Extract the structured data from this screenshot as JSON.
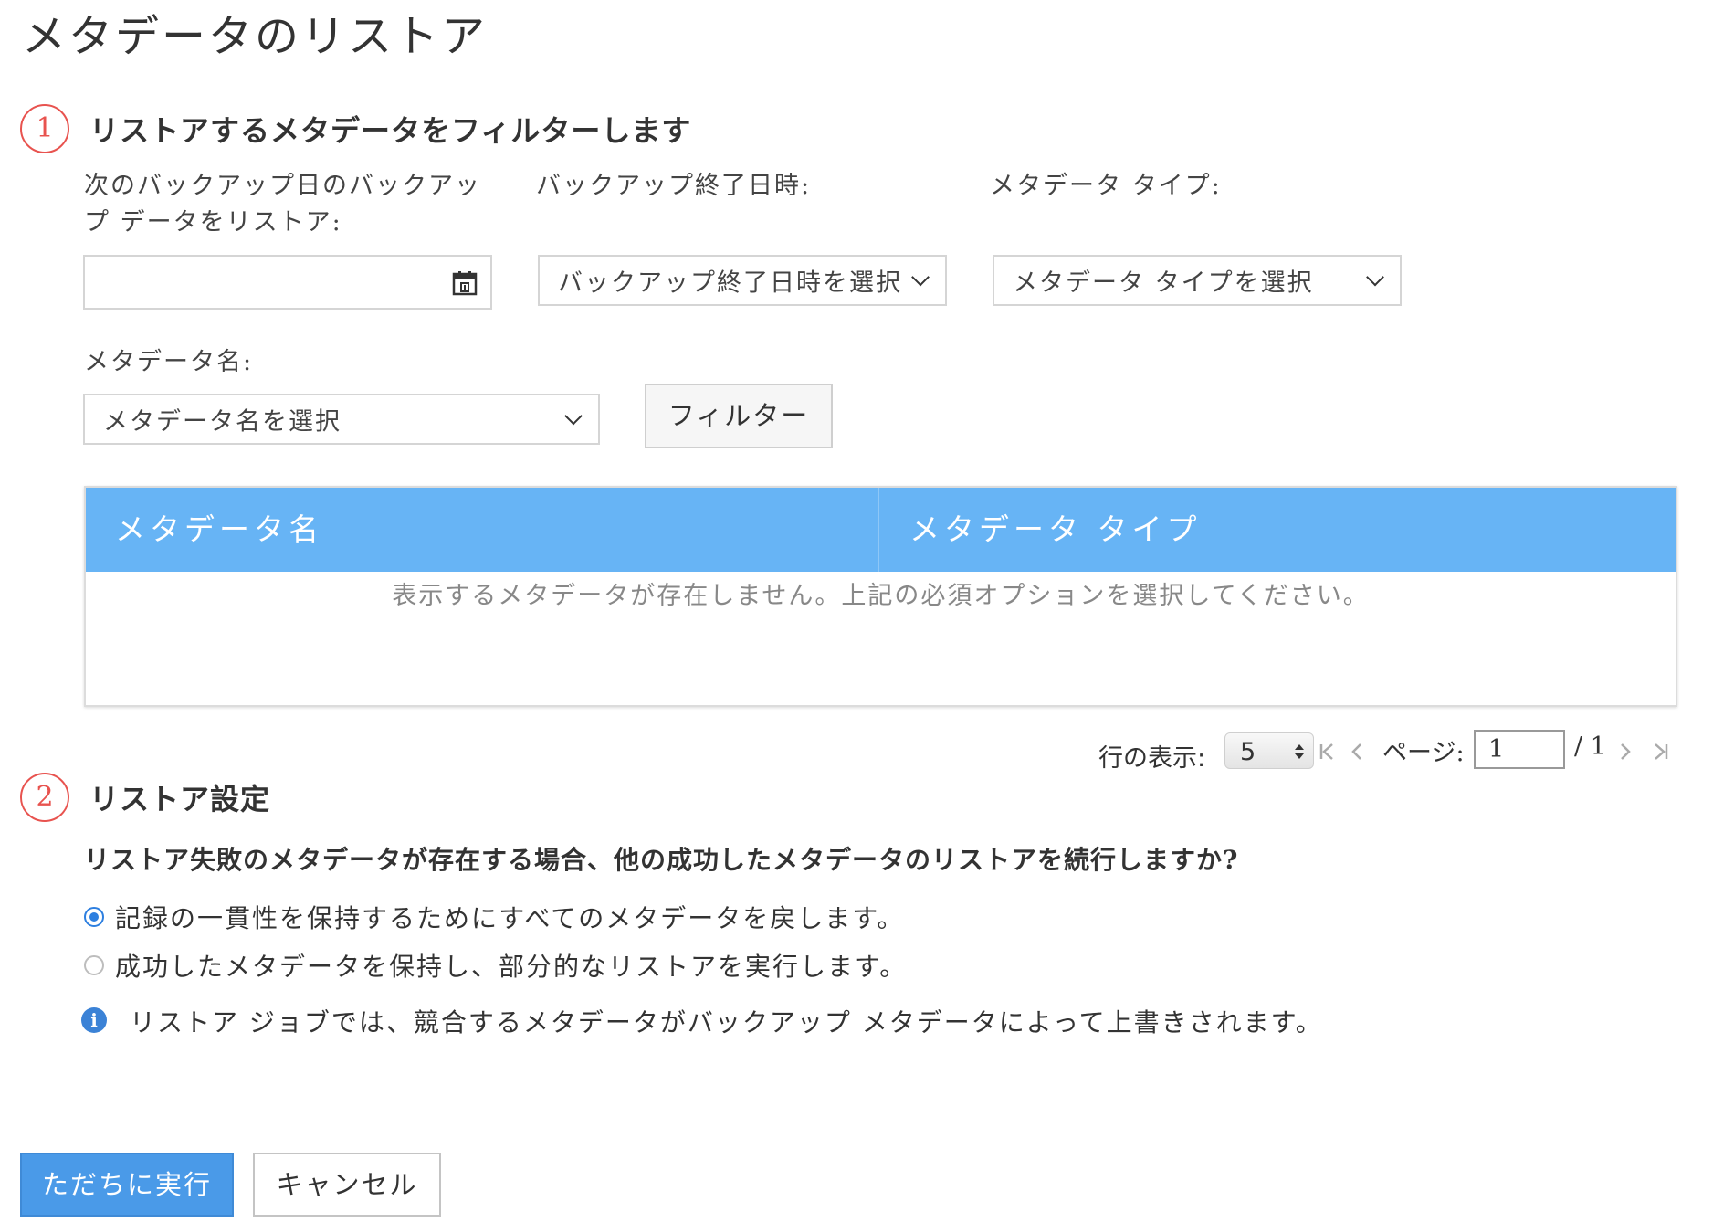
{
  "page_title": "メタデータのリストア",
  "step1": {
    "number": "1",
    "title": "リストアするメタデータをフィルターします",
    "backup_date_label_line1": "次のバックアップ日のバックアッ",
    "backup_date_label_line2": "プ データをリストア:",
    "backup_date_value": "",
    "backup_end_label": "バックアップ終了日時:",
    "backup_end_select": "バックアップ終了日時を選択",
    "metadata_type_label": "メタデータ タイプ:",
    "metadata_type_select": "メタデータ タイプを選択",
    "metadata_name_label": "メタデータ名:",
    "metadata_name_select": "メタデータ名を選択",
    "filter_button": "フィルター"
  },
  "table": {
    "columns": [
      "メタデータ名",
      "メタデータ タイプ"
    ],
    "empty_message": "表示するメタデータが存在しません。上記の必須オプションを選択してください。"
  },
  "pager": {
    "rows_label": "行の表示:",
    "rows_value": "5",
    "page_label": "ページ:",
    "page_value": "1",
    "total_pages": "/ 1"
  },
  "step2": {
    "number": "2",
    "title": "リストア設定",
    "question": "リストア失敗のメタデータが存在する場合、他の成功したメタデータのリストアを続行しますか?",
    "option1": "記録の一貫性を保持するためにすべてのメタデータを戻します。",
    "option2": "成功したメタデータを保持し、部分的なリストアを実行します。",
    "info": "リストア ジョブでは、競合するメタデータがバックアップ メタデータによって上書きされます。"
  },
  "footer": {
    "run_button": "ただちに実行",
    "cancel_button": "キャンセル"
  },
  "colors": {
    "accent_blue": "#67b4f5",
    "primary_button": "#4a9ae8",
    "step_red": "#e8534f",
    "radio_blue": "#2d7fe0"
  },
  "icons": [
    "calendar-icon",
    "chevron-down-icon",
    "first-page-icon",
    "prev-page-icon",
    "next-page-icon",
    "last-page-icon",
    "info-icon"
  ]
}
